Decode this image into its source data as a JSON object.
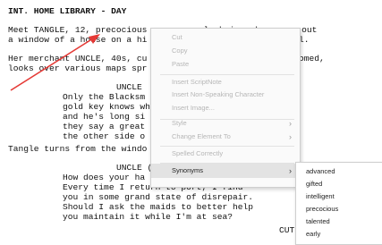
{
  "script": {
    "scene_heading": "INT. HOME LIBRARY - DAY",
    "action1_l1": "Meet TANGLE, 12, precocious eyes, unruly hair, she gazes out",
    "action1_l2": "a window of a house on a hi",
    "action1_l2_tail": "l.",
    "action2_l1": "Her merchant UNCLE, 40s, cu",
    "action2_l1_tail": "omed,",
    "action2_l2": "looks over various maps spr",
    "char1": "UNCLE",
    "dialog1": [
      "Only the Blacksm",
      "gold key knows wh",
      "and he's long si",
      "they say a great",
      "the other side o"
    ],
    "action3": "Tangle turns from the windo",
    "char2": "UNCLE (",
    "dialog2": [
      "How does your ha",
      "Every time I return to port, I find",
      "you in some grand state of disrepair.",
      "Should I ask the maids to better help",
      "you maintain it while I'm at sea?"
    ],
    "transition": "CUT"
  },
  "context_menu": {
    "items": [
      {
        "label": "Cut",
        "enabled": false
      },
      {
        "label": "Copy",
        "enabled": false
      },
      {
        "label": "Paste",
        "enabled": false
      },
      {
        "label": "Insert ScriptNote",
        "enabled": false
      },
      {
        "label": "Insert Non-Speaking Character",
        "enabled": false
      },
      {
        "label": "Insert Image...",
        "enabled": false
      },
      {
        "label": "Style",
        "enabled": false,
        "submenu_arrow": "›"
      },
      {
        "label": "Change Element To",
        "enabled": false,
        "submenu_arrow": "›"
      },
      {
        "label": "Spelled Correctly",
        "enabled": false
      },
      {
        "label": "Synonyms",
        "enabled": true,
        "active": true,
        "submenu_arrow": "›"
      }
    ]
  },
  "synonyms_menu": {
    "items": [
      "advanced",
      "gifted",
      "intelligent",
      "precocious",
      "talented",
      "early"
    ]
  },
  "colors": {
    "annotation_arrow": "#e53935",
    "menu_background": "#fafafa",
    "menu_disabled_text": "#b6b6b6",
    "menu_active_background": "#e3e3e3"
  }
}
